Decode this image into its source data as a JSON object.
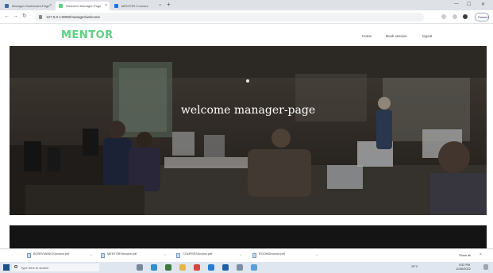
{
  "browser": {
    "tabs": [
      {
        "title": "Manager-Dashboard-Page",
        "favicon_color": "#3a6ea5",
        "active": false
      },
      {
        "title": "Welcome-Manager-Page",
        "favicon_color": "#5fcf80",
        "active": true
      },
      {
        "title": "MENTOR-Courses",
        "favicon_color": "#1a73e8",
        "active": false
      }
    ],
    "new_tab_label": "+",
    "address": "127.0.0.1:8000/manager/welcome",
    "profile_label": "Paused"
  },
  "site": {
    "logo": "MENTOR",
    "nav": {
      "home": "Home",
      "book_session": "Book session",
      "logout": "logout"
    }
  },
  "hero": {
    "title": "welcome manager-page"
  },
  "downloads": {
    "items": [
      {
        "name": "BORROWINGSInvoice.pdf"
      },
      {
        "name": "MENTORSInvoice.pdf"
      },
      {
        "name": "COURSESInvoice.pdf"
      },
      {
        "name": "ROOMSInvoice.pdf"
      }
    ],
    "show_all": "Show all"
  },
  "taskbar": {
    "search_placeholder": "Type here to search",
    "temperature": "25°C",
    "time": "4:52 PM",
    "date": "11/06/2022"
  },
  "colors": {
    "brand": "#5fcf80",
    "hero_overlay": "#000000",
    "dark_section": "#141414"
  }
}
